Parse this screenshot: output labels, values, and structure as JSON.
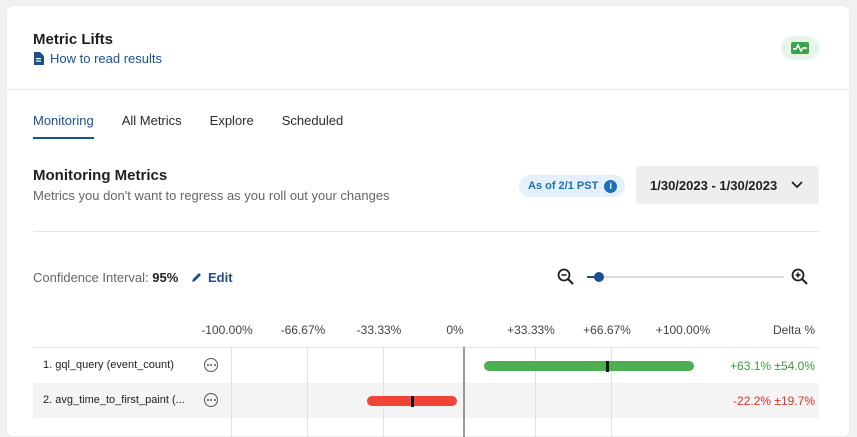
{
  "header": {
    "title": "Metric Lifts",
    "howto_label": "How to read results"
  },
  "tabs": [
    {
      "label": "Monitoring",
      "active": true
    },
    {
      "label": "All Metrics",
      "active": false
    },
    {
      "label": "Explore",
      "active": false
    },
    {
      "label": "Scheduled",
      "active": false
    }
  ],
  "section": {
    "title": "Monitoring Metrics",
    "subtitle": "Metrics you don't want to regress as you roll out your changes",
    "asof_label": "As of 2/1 PST",
    "date_range": "1/30/2023 - 1/30/2023"
  },
  "confidence": {
    "label": "Confidence Interval:",
    "value": "95%",
    "edit_label": "Edit"
  },
  "zoom": {
    "level": 0.05
  },
  "colors": {
    "accent": "#1d4f8c",
    "positive": "#4caf50",
    "negative": "#f04438",
    "positive_text": "#3a9a3e",
    "negative_text": "#e0312a"
  },
  "chart_data": {
    "type": "bar",
    "xlim": [
      -133.33,
      133.33
    ],
    "ticks": [
      "-100.00%",
      "-66.67%",
      "-33.33%",
      "0%",
      "+33.33%",
      "+66.67%",
      "+100.00%"
    ],
    "tick_values": [
      -100,
      -66.67,
      -33.33,
      0,
      33.33,
      66.67,
      100
    ],
    "delta_header": "Delta %",
    "rows": [
      {
        "index": "1.",
        "name": "gql_query (event_count)",
        "value": 63.1,
        "ci": 54.0,
        "delta_text": "+63.1% ±54.0%",
        "direction": "positive"
      },
      {
        "index": "2.",
        "name": "avg_time_to_first_paint (...",
        "value": -22.2,
        "ci": 19.7,
        "delta_text": "-22.2% ±19.7%",
        "direction": "negative"
      }
    ]
  }
}
